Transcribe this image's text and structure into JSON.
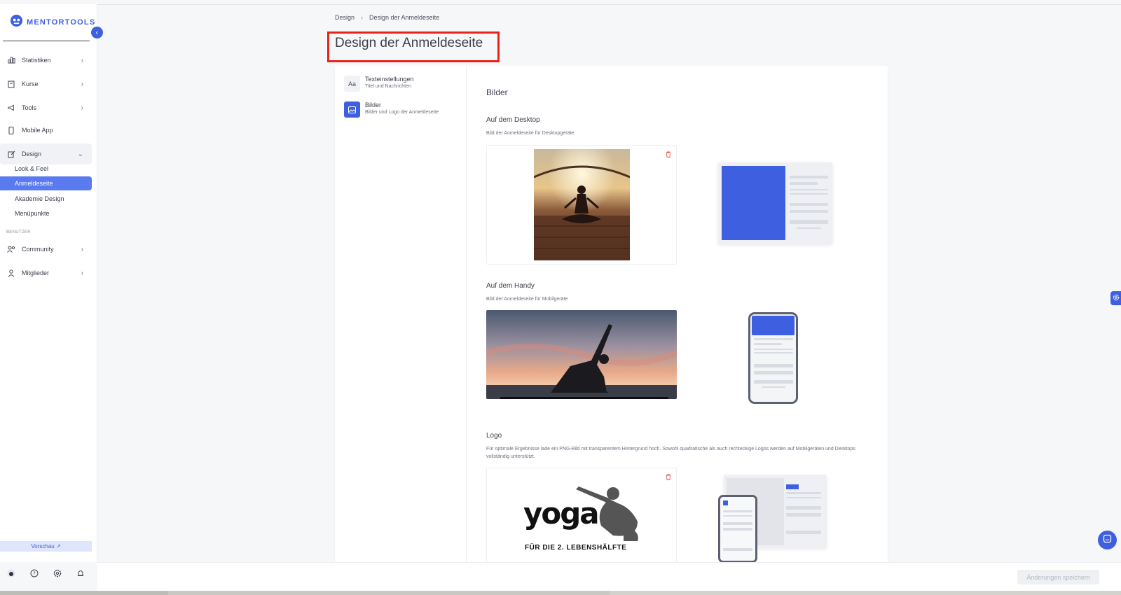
{
  "brand": {
    "name": "MENTORTOOLS"
  },
  "sidebar": {
    "items": [
      {
        "label": "Statistiken",
        "icon": "bar-chart-icon"
      },
      {
        "label": "Kurse",
        "icon": "book-icon"
      },
      {
        "label": "Tools",
        "icon": "megaphone-icon"
      },
      {
        "label": "Mobile App",
        "icon": "phone-icon"
      },
      {
        "label": "Design",
        "icon": "pencil-icon"
      }
    ],
    "design_sub": [
      "Look & Feel",
      "Anmeldeseite",
      "Akademie Design",
      "Menüpunkte"
    ],
    "section_label": "BENUTZER",
    "user_items": [
      {
        "label": "Community",
        "icon": "users-icon"
      },
      {
        "label": "Mitglieder",
        "icon": "user-icon"
      }
    ],
    "preview_label": "Vorschau ↗"
  },
  "breadcrumb": {
    "parent": "Design",
    "current": "Design der Anmeldeseite"
  },
  "page_title": "Design der Anmeldeseite",
  "settings_menu": [
    {
      "title": "Texteinstellungen",
      "subtitle": "Titel und Nachrichten",
      "icon_text": "Aa"
    },
    {
      "title": "Bilder",
      "subtitle": "Bilder und Logo der Anmeldeseite"
    }
  ],
  "content": {
    "heading": "Bilder",
    "desktop": {
      "title": "Auf dem Desktop",
      "subtitle": "Bild der Anmeldeseite für Desktopgeräte"
    },
    "mobile": {
      "title": "Auf dem Handy",
      "subtitle": "Bild der Anmeldeseite für Mobilgeräte"
    },
    "logo": {
      "title": "Logo",
      "subtitle": "Für optimale Ergebnisse lade ein PNG-Bild mit transparentem Hintergrund hoch. Sowohl quadratische als auch rechteckige Logos werden auf Mobilgeräten und Desktops vollständig unterstützt.",
      "logo_word": "yoga",
      "logo_tagline": "FÜR DIE 2. LEBENSHÄLFTE"
    }
  },
  "footer": {
    "save_label": "Änderungen speichern"
  },
  "colors": {
    "accent": "#3e5fe0",
    "active_item": "#5a7af0",
    "highlight_box": "#e8231a",
    "danger": "#e8504a"
  }
}
